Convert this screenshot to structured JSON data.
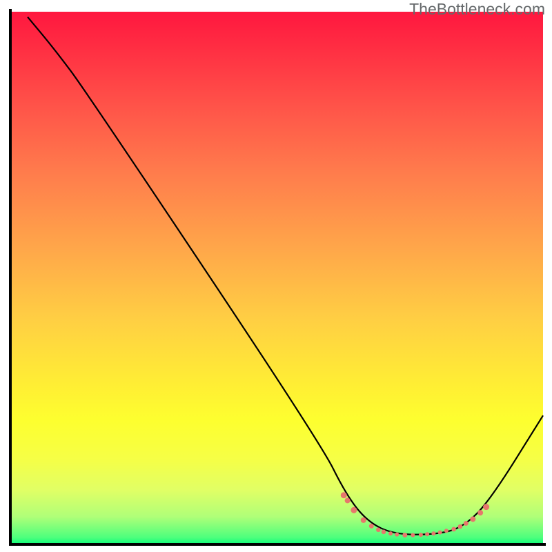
{
  "watermark": "TheBottleneck.com",
  "chart_data": {
    "type": "line",
    "title": "",
    "xlabel": "",
    "ylabel": "",
    "xlim": [
      0,
      100
    ],
    "ylim": [
      0,
      100
    ],
    "series": [
      {
        "name": "curve",
        "points": [
          {
            "x": 3,
            "y": 99
          },
          {
            "x": 8,
            "y": 93
          },
          {
            "x": 14,
            "y": 85
          },
          {
            "x": 58,
            "y": 19
          },
          {
            "x": 63,
            "y": 9
          },
          {
            "x": 67,
            "y": 4
          },
          {
            "x": 72,
            "y": 1.6
          },
          {
            "x": 80,
            "y": 1.6
          },
          {
            "x": 85,
            "y": 3
          },
          {
            "x": 90,
            "y": 8
          },
          {
            "x": 100,
            "y": 24
          }
        ]
      }
    ],
    "markers": [
      {
        "x": 62.5,
        "y": 9,
        "r": 4.5
      },
      {
        "x": 63.2,
        "y": 8,
        "r": 4
      },
      {
        "x": 64.4,
        "y": 6.2,
        "r": 4.5
      },
      {
        "x": 66.2,
        "y": 4.3,
        "r": 4
      },
      {
        "x": 67.7,
        "y": 3.2,
        "r": 3.5
      },
      {
        "x": 69,
        "y": 2.5,
        "r": 3.3
      },
      {
        "x": 70,
        "y": 2.1,
        "r": 3.3
      },
      {
        "x": 71.3,
        "y": 1.8,
        "r": 3
      },
      {
        "x": 72.5,
        "y": 1.6,
        "r": 3
      },
      {
        "x": 74,
        "y": 1.5,
        "r": 3.5
      },
      {
        "x": 75.5,
        "y": 1.5,
        "r": 3
      },
      {
        "x": 77,
        "y": 1.55,
        "r": 3
      },
      {
        "x": 78.2,
        "y": 1.65,
        "r": 3
      },
      {
        "x": 79.4,
        "y": 1.8,
        "r": 3
      },
      {
        "x": 80.6,
        "y": 2,
        "r": 3
      },
      {
        "x": 81.8,
        "y": 2.3,
        "r": 3
      },
      {
        "x": 83.2,
        "y": 2.6,
        "r": 3.3
      },
      {
        "x": 84.4,
        "y": 3.1,
        "r": 3.3
      },
      {
        "x": 85.5,
        "y": 3.7,
        "r": 3.5
      },
      {
        "x": 86.8,
        "y": 4.5,
        "r": 4
      },
      {
        "x": 88.2,
        "y": 5.7,
        "r": 4
      },
      {
        "x": 89.3,
        "y": 6.8,
        "r": 4.5
      }
    ],
    "colors": {
      "curve": "#000000",
      "marker": "#e6786c"
    }
  }
}
